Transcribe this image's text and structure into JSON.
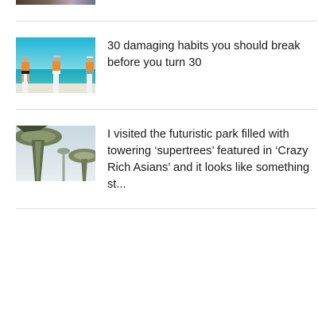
{
  "feed": {
    "articles": [
      {
        "headline": "30 damaging habits you should break before you turn 30",
        "thumbnail": "three-men-on-pillars-beach"
      },
      {
        "headline": "I visited the futuristic park filled with towering ‘supertrees’ featured in ‘Crazy Rich Asians’ and it looks like something st...",
        "thumbnail": "supertrees-from-below"
      }
    ]
  },
  "colors": {
    "divider": "#dcdcdc",
    "headline_text": "#1a1a1a",
    "sea": "#2fb7c6",
    "sky": "#d8e4ea"
  }
}
